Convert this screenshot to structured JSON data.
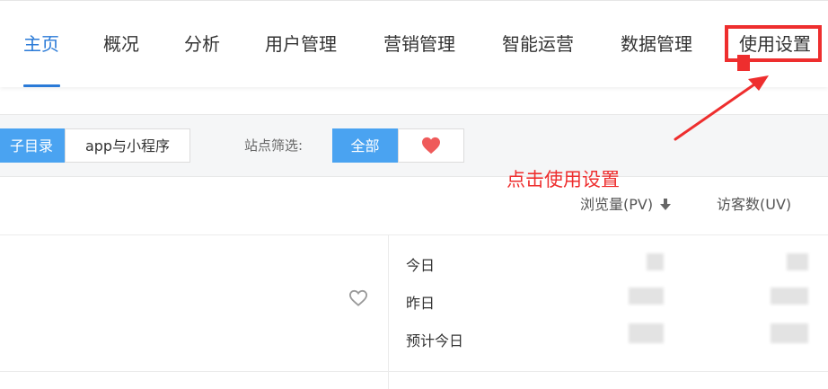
{
  "nav": {
    "items": [
      {
        "label": "主页",
        "active": true
      },
      {
        "label": "概况"
      },
      {
        "label": "分析"
      },
      {
        "label": "用户管理"
      },
      {
        "label": "营销管理"
      },
      {
        "label": "智能运营"
      },
      {
        "label": "数据管理"
      },
      {
        "label": "使用设置"
      }
    ]
  },
  "filters": {
    "segment_left": "子目录",
    "segment_right": "app与小程序",
    "site_label": "站点筛选:",
    "site_all": "全部",
    "site_icon": "heart-icon"
  },
  "annotation": {
    "text": "点击使用设置",
    "color": "#ee2e2e"
  },
  "table": {
    "columns": [
      "浏览量(PV)",
      "访客数(UV)"
    ],
    "rows": [
      "今日",
      "昨日",
      "预计今日"
    ]
  },
  "colors": {
    "accent": "#2a7ad7",
    "segment_active": "#4aa3f1",
    "annotation": "#ee2e2e"
  }
}
